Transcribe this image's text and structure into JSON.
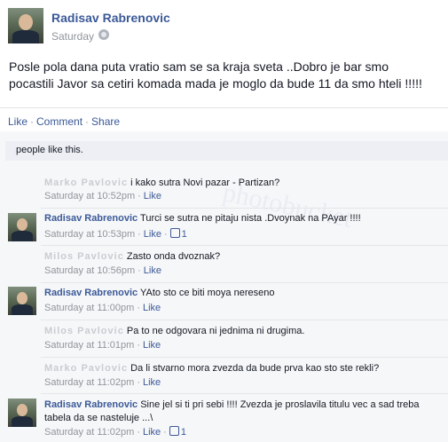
{
  "post": {
    "author": "Radisav Rabrenovic",
    "time": "Saturday",
    "text": "Posle pola dana puta vratio sam se sa kraja sveta ..Dobro je bar smo pocastili Javor sa cetiri komada mada je moglo da bude 11 da smo hteli !!!!!"
  },
  "actions": {
    "like": "Like",
    "comment": "Comment",
    "share": "Share",
    "sep": "·"
  },
  "likes": {
    "text": "people like this."
  },
  "watermark": "photobucket",
  "comments": [
    {
      "name": "Marko Pavlovic",
      "name_blurred": true,
      "text": "i kako sutra Novi pazar - Partizan?",
      "time": "Saturday at 10:52pm",
      "like": "Like",
      "likes": ""
    },
    {
      "name": "Radisav Rabrenovic",
      "name_blurred": false,
      "text": "Turci se sutra ne pitaju nista .Dvoynak na PAyar !!!!",
      "time": "Saturday at 10:53pm",
      "like": "Like",
      "likes": "1"
    },
    {
      "name": "Milos Pavlovic",
      "name_blurred": true,
      "text": "Zasto onda dvoznak?",
      "time": "Saturday at 10:56pm",
      "like": "Like",
      "likes": ""
    },
    {
      "name": "Radisav Rabrenovic",
      "name_blurred": false,
      "text": "YAto sto ce biti moya nereseno",
      "time": "Saturday at 11:00pm",
      "like": "Like",
      "likes": ""
    },
    {
      "name": "Milos Pavlovic",
      "name_blurred": true,
      "text": "Pa to ne odgovara ni jednima ni drugima.",
      "time": "Saturday at 11:01pm",
      "like": "Like",
      "likes": ""
    },
    {
      "name": "Marko Pavlovic",
      "name_blurred": true,
      "text": "Da li stvarno mora zvezda da bude prva kao sto ste rekli?",
      "time": "Saturday at 11:02pm",
      "like": "Like",
      "likes": ""
    },
    {
      "name": "Radisav Rabrenovic",
      "name_blurred": false,
      "text": "Sine jel si ti pri sebi !!!! Zvezda je proslavila titulu vec a sad treba tabela da se nasteluje ...\\",
      "time": "Saturday at 11:02pm",
      "like": "Like",
      "likes": "1"
    }
  ]
}
